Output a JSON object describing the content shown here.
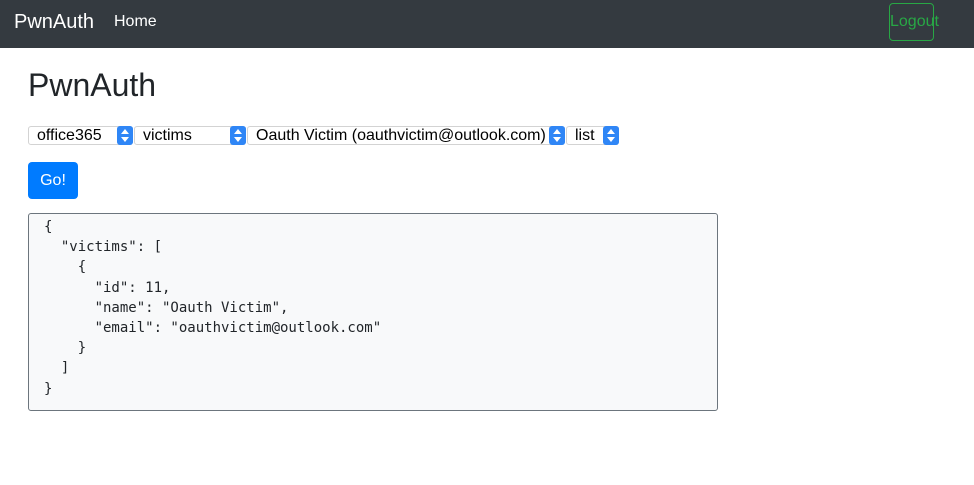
{
  "navbar": {
    "brand": "PwnAuth",
    "home_label": "Home",
    "logout_label": "Logout"
  },
  "page": {
    "title": "PwnAuth"
  },
  "selects": {
    "app": "office365",
    "resource": "victims",
    "victim": "Oauth Victim (oauthvictim@outlook.com)",
    "action": "list"
  },
  "go_button_label": "Go!",
  "output_json": "{\n  \"victims\": [\n    {\n      \"id\": 11,\n      \"name\": \"Oauth Victim\",\n      \"email\": \"oauthvictim@outlook.com\"\n    }\n  ]\n}",
  "colors": {
    "navbar_bg": "#343a40",
    "logout_green": "#28a745",
    "primary_blue": "#007bff",
    "select_arrow_blue": "#2f86f6"
  }
}
